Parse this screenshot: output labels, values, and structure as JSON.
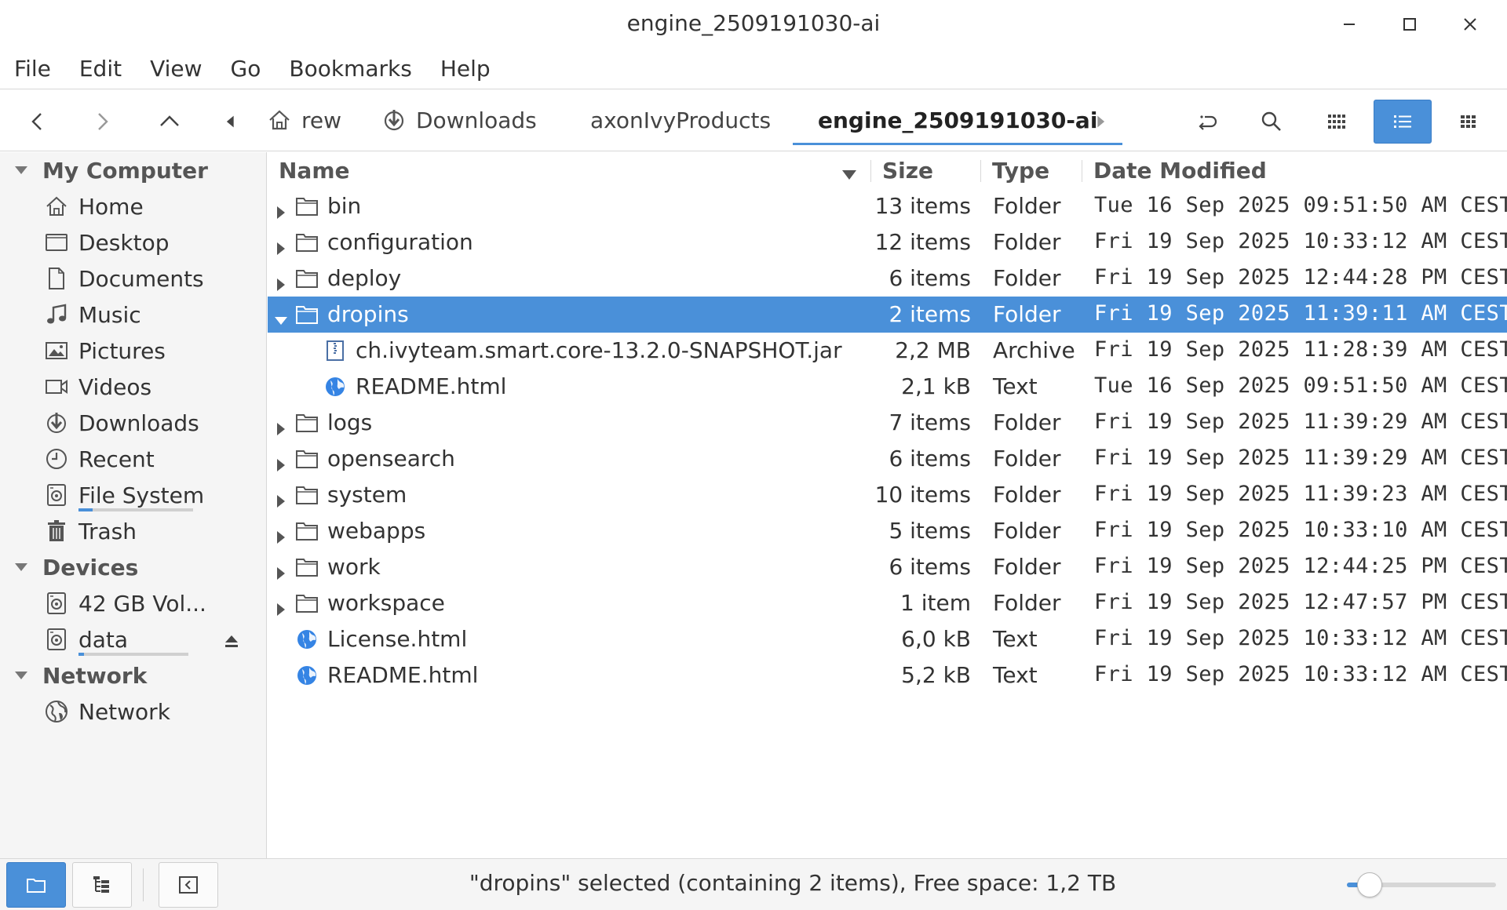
{
  "window": {
    "title": "engine_2509191030-ai"
  },
  "menu": [
    "File",
    "Edit",
    "View",
    "Go",
    "Bookmarks",
    "Help"
  ],
  "breadcrumbs": [
    {
      "label": "rew",
      "icon": "home-icon"
    },
    {
      "label": "Downloads",
      "icon": "download-icon"
    },
    {
      "label": "axonIvyProducts",
      "icon": ""
    },
    {
      "label": "engine_2509191030-ai",
      "icon": "",
      "active": true
    }
  ],
  "view_mode": "list",
  "sidebar": {
    "sections": [
      {
        "label": "My Computer",
        "items": [
          {
            "label": "Home",
            "icon": "home-icon"
          },
          {
            "label": "Desktop",
            "icon": "desktop-icon"
          },
          {
            "label": "Documents",
            "icon": "document-icon"
          },
          {
            "label": "Music",
            "icon": "music-icon"
          },
          {
            "label": "Pictures",
            "icon": "pictures-icon"
          },
          {
            "label": "Videos",
            "icon": "video-icon"
          },
          {
            "label": "Downloads",
            "icon": "download-icon"
          },
          {
            "label": "Recent",
            "icon": "clock-icon"
          },
          {
            "label": "File System",
            "icon": "drive-icon",
            "usage": 0.12
          },
          {
            "label": "Trash",
            "icon": "trash-icon"
          }
        ]
      },
      {
        "label": "Devices",
        "items": [
          {
            "label": "42 GB Vol...",
            "icon": "drive-icon"
          },
          {
            "label": "data",
            "icon": "drive-icon",
            "usage": 0.05,
            "eject": true
          }
        ]
      },
      {
        "label": "Network",
        "items": [
          {
            "label": "Network",
            "icon": "network-icon"
          }
        ]
      }
    ]
  },
  "columns": {
    "name": "Name",
    "size": "Size",
    "type": "Type",
    "date": "Date Modified"
  },
  "files": [
    {
      "name": "bin",
      "size": "13 items",
      "type": "Folder",
      "date": "Tue 16 Sep 2025 09:51:50 AM CEST",
      "kind": "folder",
      "depth": 0,
      "expander": "collapsed"
    },
    {
      "name": "configuration",
      "size": "12 items",
      "type": "Folder",
      "date": "Fri 19 Sep 2025 10:33:12 AM CEST",
      "kind": "folder",
      "depth": 0,
      "expander": "collapsed"
    },
    {
      "name": "deploy",
      "size": "6 items",
      "type": "Folder",
      "date": "Fri 19 Sep 2025 12:44:28 PM CEST",
      "kind": "folder",
      "depth": 0,
      "expander": "collapsed"
    },
    {
      "name": "dropins",
      "size": "2 items",
      "type": "Folder",
      "date": "Fri 19 Sep 2025 11:39:11 AM CEST",
      "kind": "folder",
      "depth": 0,
      "expander": "expanded",
      "selected": true
    },
    {
      "name": "ch.ivyteam.smart.core-13.2.0-SNAPSHOT.jar",
      "size": "2,2 MB",
      "type": "Archive",
      "date": "Fri 19 Sep 2025 11:28:39 AM CEST",
      "kind": "archive",
      "depth": 1,
      "expander": "none"
    },
    {
      "name": "README.html",
      "size": "2,1 kB",
      "type": "Text",
      "date": "Tue 16 Sep 2025 09:51:50 AM CEST",
      "kind": "html",
      "depth": 1,
      "expander": "none"
    },
    {
      "name": "logs",
      "size": "7 items",
      "type": "Folder",
      "date": "Fri 19 Sep 2025 11:39:29 AM CEST",
      "kind": "folder",
      "depth": 0,
      "expander": "collapsed"
    },
    {
      "name": "opensearch",
      "size": "6 items",
      "type": "Folder",
      "date": "Fri 19 Sep 2025 11:39:29 AM CEST",
      "kind": "folder",
      "depth": 0,
      "expander": "collapsed"
    },
    {
      "name": "system",
      "size": "10 items",
      "type": "Folder",
      "date": "Fri 19 Sep 2025 11:39:23 AM CEST",
      "kind": "folder",
      "depth": 0,
      "expander": "collapsed"
    },
    {
      "name": "webapps",
      "size": "5 items",
      "type": "Folder",
      "date": "Fri 19 Sep 2025 10:33:10 AM CEST",
      "kind": "folder",
      "depth": 0,
      "expander": "collapsed"
    },
    {
      "name": "work",
      "size": "6 items",
      "type": "Folder",
      "date": "Fri 19 Sep 2025 12:44:25 PM CEST",
      "kind": "folder",
      "depth": 0,
      "expander": "collapsed"
    },
    {
      "name": "workspace",
      "size": "1 item",
      "type": "Folder",
      "date": "Fri 19 Sep 2025 12:47:57 PM CEST",
      "kind": "folder",
      "depth": 0,
      "expander": "collapsed"
    },
    {
      "name": "License.html",
      "size": "6,0 kB",
      "type": "Text",
      "date": "Fri 19 Sep 2025 10:33:12 AM CEST",
      "kind": "html",
      "depth": 0,
      "expander": "none"
    },
    {
      "name": "README.html",
      "size": "5,2 kB",
      "type": "Text",
      "date": "Fri 19 Sep 2025 10:33:12 AM CEST",
      "kind": "html",
      "depth": 0,
      "expander": "none"
    }
  ],
  "status": {
    "text": "\"dropins\" selected (containing 2 items), Free space: 1,2 TB",
    "zoom_fraction": 0.15
  },
  "colors": {
    "accent": "#4a90d9",
    "sidebar_bg": "#f5f5f5",
    "text": "#333333"
  }
}
